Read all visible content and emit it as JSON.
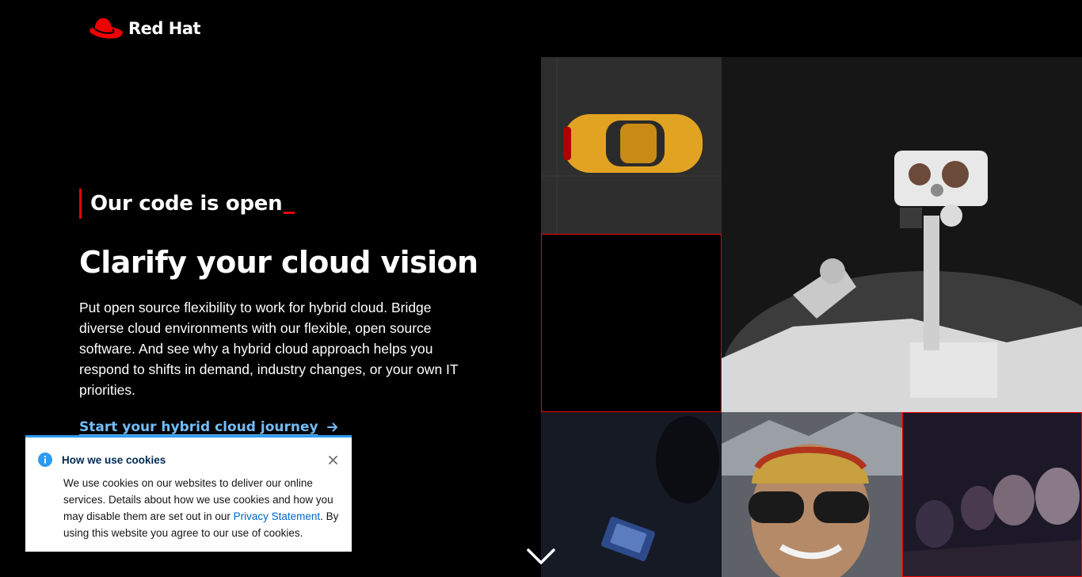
{
  "brand": {
    "name": "Red Hat",
    "accent": "#ee0000"
  },
  "hero": {
    "eyebrow": "Our code is open",
    "headline": "Clarify your cloud vision",
    "body": "Put open source flexibility to work for hybrid cloud. Bridge diverse cloud environments with our flexible, open source software. And see why a hybrid cloud approach helps you respond to shifts in demand, industry changes, or your own IT priorities.",
    "cta_label": "Start your hybrid cloud journey",
    "cta_color": "#73bcf7"
  },
  "mosaic": {
    "tiles": [
      "car-photo",
      "empty-red-outline",
      "robot-rover-photo",
      "phone-photo",
      "woman-sunglasses-photo",
      "audience-photo"
    ]
  },
  "cookie_banner": {
    "title": "How we use cookies",
    "body_before_link": "We use cookies on our websites to deliver our online services. Details about how we use cookies and how you may disable them are set out in our ",
    "link_label": "Privacy Statement",
    "body_after_link": ". By using this website you agree to our use of cookies.",
    "icon": "info-icon",
    "close_icon": "close-icon",
    "accent": "#2b9af3"
  },
  "scroll_indicator": {
    "icon": "chevron-down-icon"
  }
}
